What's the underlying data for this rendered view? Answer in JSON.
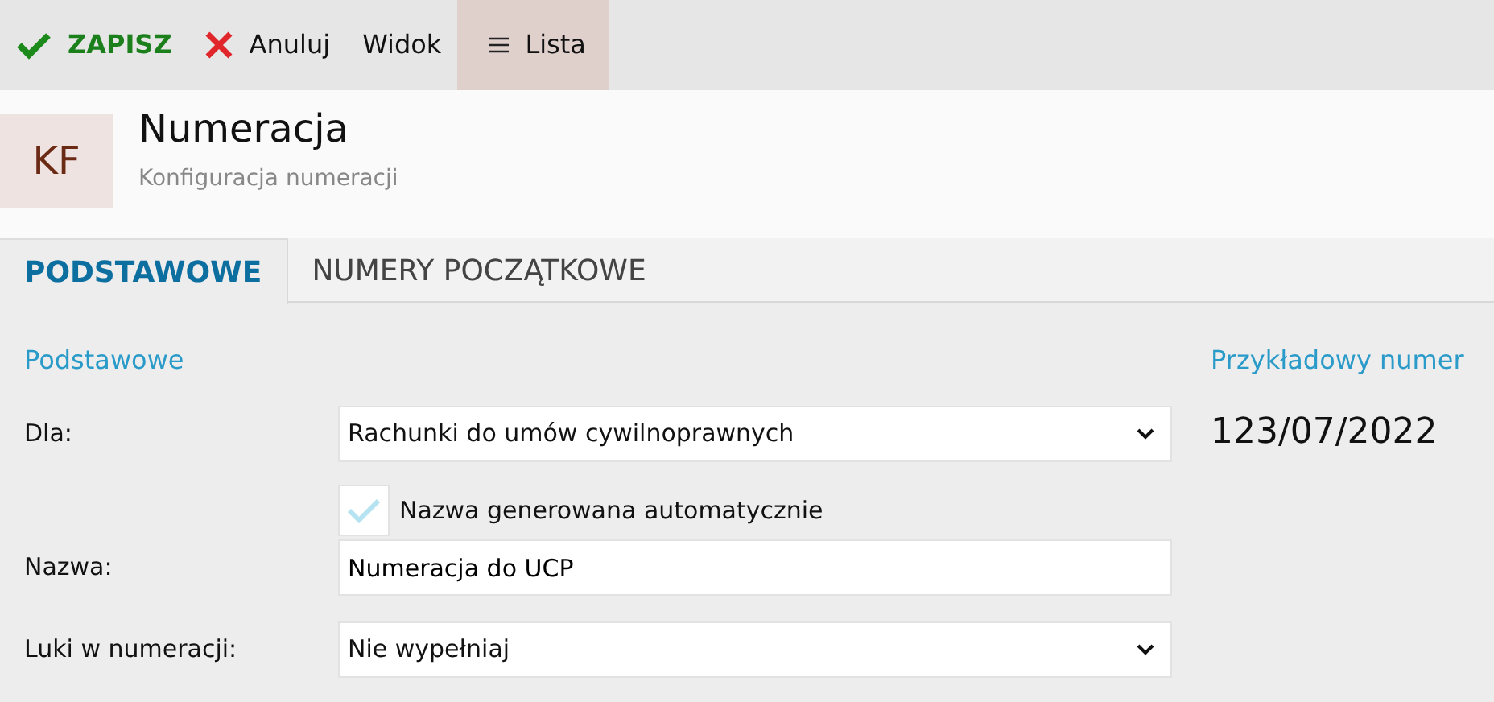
{
  "toolbar": [
    {
      "kind": "save",
      "label": "ZAPISZ",
      "selected": false
    },
    {
      "kind": "cancel",
      "label": "Anuluj",
      "selected": false
    },
    {
      "kind": "plain",
      "label": "Widok",
      "selected": false
    },
    {
      "kind": "menu",
      "label": "Lista",
      "selected": true
    }
  ],
  "header": {
    "initials": "KF",
    "title": "Numeracja",
    "subtitle": "Konfiguracja numeracji"
  },
  "tabs": [
    {
      "label": "PODSTAWOWE",
      "selected": true
    },
    {
      "label": "NUMERY POCZĄTKOWE",
      "selected": false
    }
  ],
  "section_title": "Podstawowe",
  "fields": [
    {
      "kind": "select",
      "label": "Dla:",
      "value": "Rachunki do umów cywilnoprawnych"
    },
    {
      "kind": "checkbox",
      "label": "Nazwa generowana automatycznie",
      "checked": true
    },
    {
      "kind": "text",
      "label": "Nazwa:",
      "value": "Numeracja do UCP"
    },
    {
      "kind": "select",
      "label": "Luki w numeracji:",
      "value": "Nie wypełniaj"
    }
  ],
  "example": {
    "title": "Przykładowy numer",
    "value": "123/07/2022"
  }
}
